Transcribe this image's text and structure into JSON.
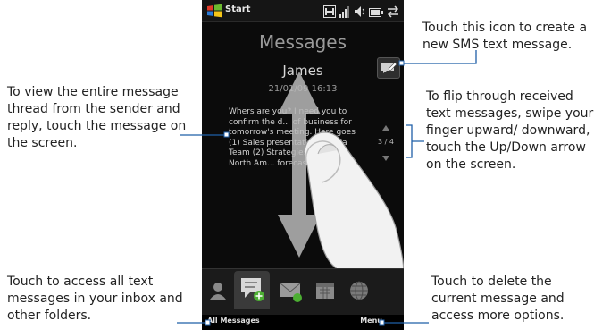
{
  "callouts": {
    "left": "To view the entire message thread from the sender and reply, touch the message on the screen.",
    "top_right": "Touch this icon to create a new SMS text message.",
    "mid_right": "To flip through received text messages, swipe your finger upward/ downward, touch the Up/Down arrow on the screen.",
    "bottom_left": "Touch to access all text messages in your inbox and other folders.",
    "bottom_right": "Touch to delete the current message and access more options."
  },
  "phone": {
    "start_label": "Start",
    "title": "Messages",
    "sender": "James",
    "timestamp": "21/01/09 16:13",
    "message_body": "Whers are you? I need you to confirm the d... of business for tomorrow's meeting. Here goes (1) Sales presentation of Asia Team (2) Strategies of... (3) North Am... forecast. Tha...",
    "pager": "3 / 4",
    "softkeys": {
      "left": "All Messages",
      "right": "Menu"
    },
    "tabs": [
      "people-tab",
      "messages-tab",
      "email-tab",
      "calendar-tab",
      "internet-tab"
    ]
  },
  "colors": {
    "phone_bg": "#0b0b0b",
    "accent_blue": "#1f5fa8",
    "messages_tab_green": "#4caf32"
  }
}
